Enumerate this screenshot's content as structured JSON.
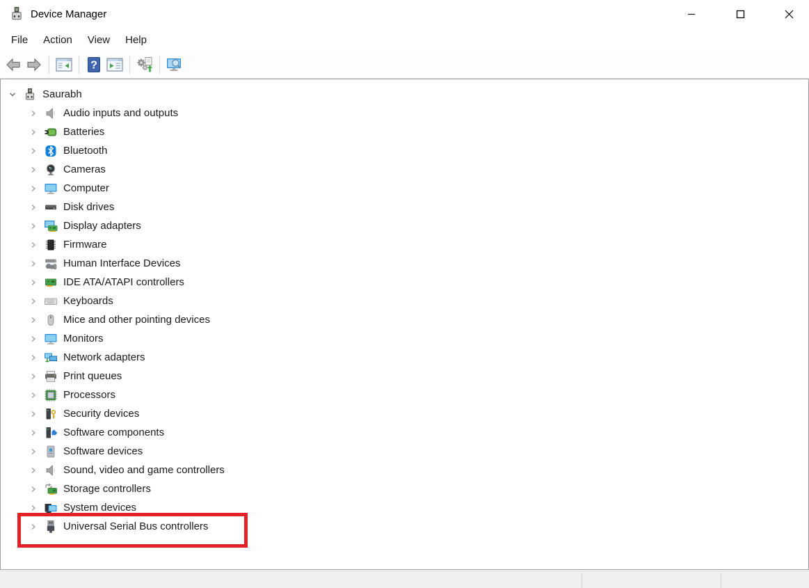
{
  "window": {
    "title": "Device Manager",
    "icon": "device-manager-icon",
    "controls": [
      "minimize",
      "maximize",
      "close"
    ]
  },
  "menubar": {
    "items": [
      "File",
      "Action",
      "View",
      "Help"
    ]
  },
  "toolbar": {
    "icons": [
      "back",
      "forward",
      "show-hide-console-tree",
      "help",
      "properties",
      "scan-for-hardware-changes",
      "device-search"
    ]
  },
  "tree": {
    "root": {
      "label": "Saurabh",
      "icon": "computer-device-icon",
      "state": "expanded"
    },
    "items": [
      {
        "label": "Audio inputs and outputs",
        "icon": "speaker-icon"
      },
      {
        "label": "Batteries",
        "icon": "battery-icon"
      },
      {
        "label": "Bluetooth",
        "icon": "bluetooth-icon"
      },
      {
        "label": "Cameras",
        "icon": "camera-icon"
      },
      {
        "label": "Computer",
        "icon": "monitor-icon"
      },
      {
        "label": "Disk drives",
        "icon": "disk-drive-icon"
      },
      {
        "label": "Display adapters",
        "icon": "display-adapter-icon"
      },
      {
        "label": "Firmware",
        "icon": "firmware-chip-icon"
      },
      {
        "label": "Human Interface Devices",
        "icon": "hid-icon"
      },
      {
        "label": "IDE ATA/ATAPI controllers",
        "icon": "ide-controller-icon"
      },
      {
        "label": "Keyboards",
        "icon": "keyboard-icon"
      },
      {
        "label": "Mice and other pointing devices",
        "icon": "mouse-icon"
      },
      {
        "label": "Monitors",
        "icon": "monitor-icon"
      },
      {
        "label": "Network adapters",
        "icon": "network-adapter-icon"
      },
      {
        "label": "Print queues",
        "icon": "printer-icon"
      },
      {
        "label": "Processors",
        "icon": "processor-icon"
      },
      {
        "label": "Security devices",
        "icon": "security-key-icon"
      },
      {
        "label": "Software components",
        "icon": "software-component-icon"
      },
      {
        "label": "Software devices",
        "icon": "software-device-icon"
      },
      {
        "label": "Sound, video and game controllers",
        "icon": "speaker-icon"
      },
      {
        "label": "Storage controllers",
        "icon": "storage-controller-icon"
      },
      {
        "label": "System devices",
        "icon": "system-device-icon"
      },
      {
        "label": "Universal Serial Bus controllers",
        "icon": "usb-plug-icon"
      }
    ]
  },
  "highlight": {
    "color": "#e32227",
    "target_label": "Universal Serial Bus controllers"
  }
}
